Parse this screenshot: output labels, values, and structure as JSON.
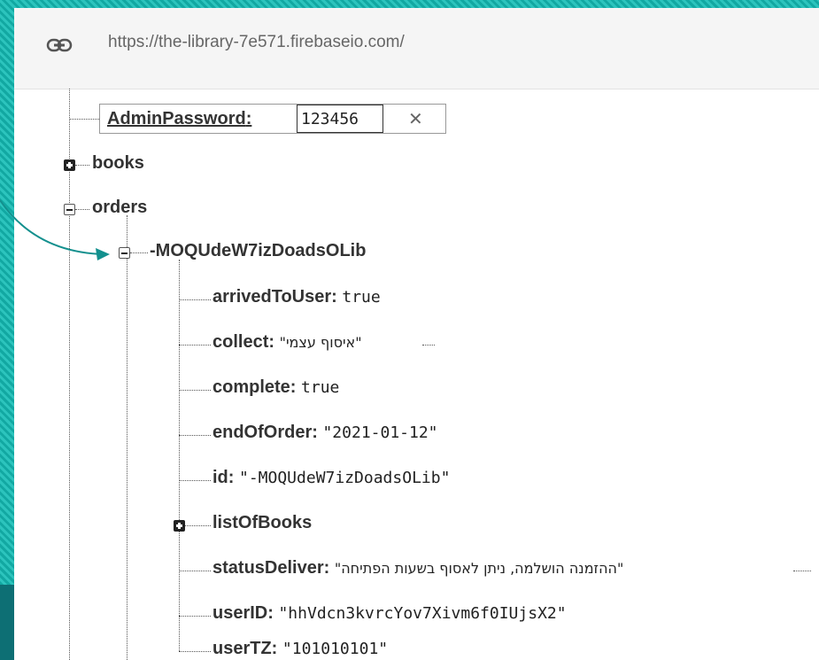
{
  "urlbar": {
    "url": "https://the-library-7e571.firebaseio.com/"
  },
  "edit": {
    "key": "AdminPassword",
    "colon": ":",
    "value": "123456"
  },
  "tree": {
    "books": "books",
    "orders": "orders",
    "order_id": "-MOQUdeW7izDoadsOLib",
    "fields": [
      {
        "key": "arrivedToUser:",
        "value": "true"
      },
      {
        "key": "collect:",
        "value": "\"איסוף עצמי\""
      },
      {
        "key": "complete:",
        "value": "true"
      },
      {
        "key": "endOfOrder:",
        "value": "\"2021-01-12\""
      },
      {
        "key": "id:",
        "value": "\"-MOQUdeW7izDoadsOLib\""
      },
      {
        "key": "listOfBooks",
        "value": ""
      },
      {
        "key": "statusDeliver:",
        "value": "\"ההזמנה הושלמה, ניתן לאסוף בשעות הפתיחה\""
      },
      {
        "key": "userID:",
        "value": "\"hhVdcn3kvrcYov7Xivm6f0IUjsX2\""
      },
      {
        "key": "userTZ:",
        "value": "\"101010101\""
      }
    ]
  },
  "colors": {
    "frame": "#1cb3ad",
    "arrow": "#13908e"
  },
  "icons": [
    "link-icon",
    "close-icon",
    "plus-toggle-icon",
    "minus-toggle-icon"
  ]
}
